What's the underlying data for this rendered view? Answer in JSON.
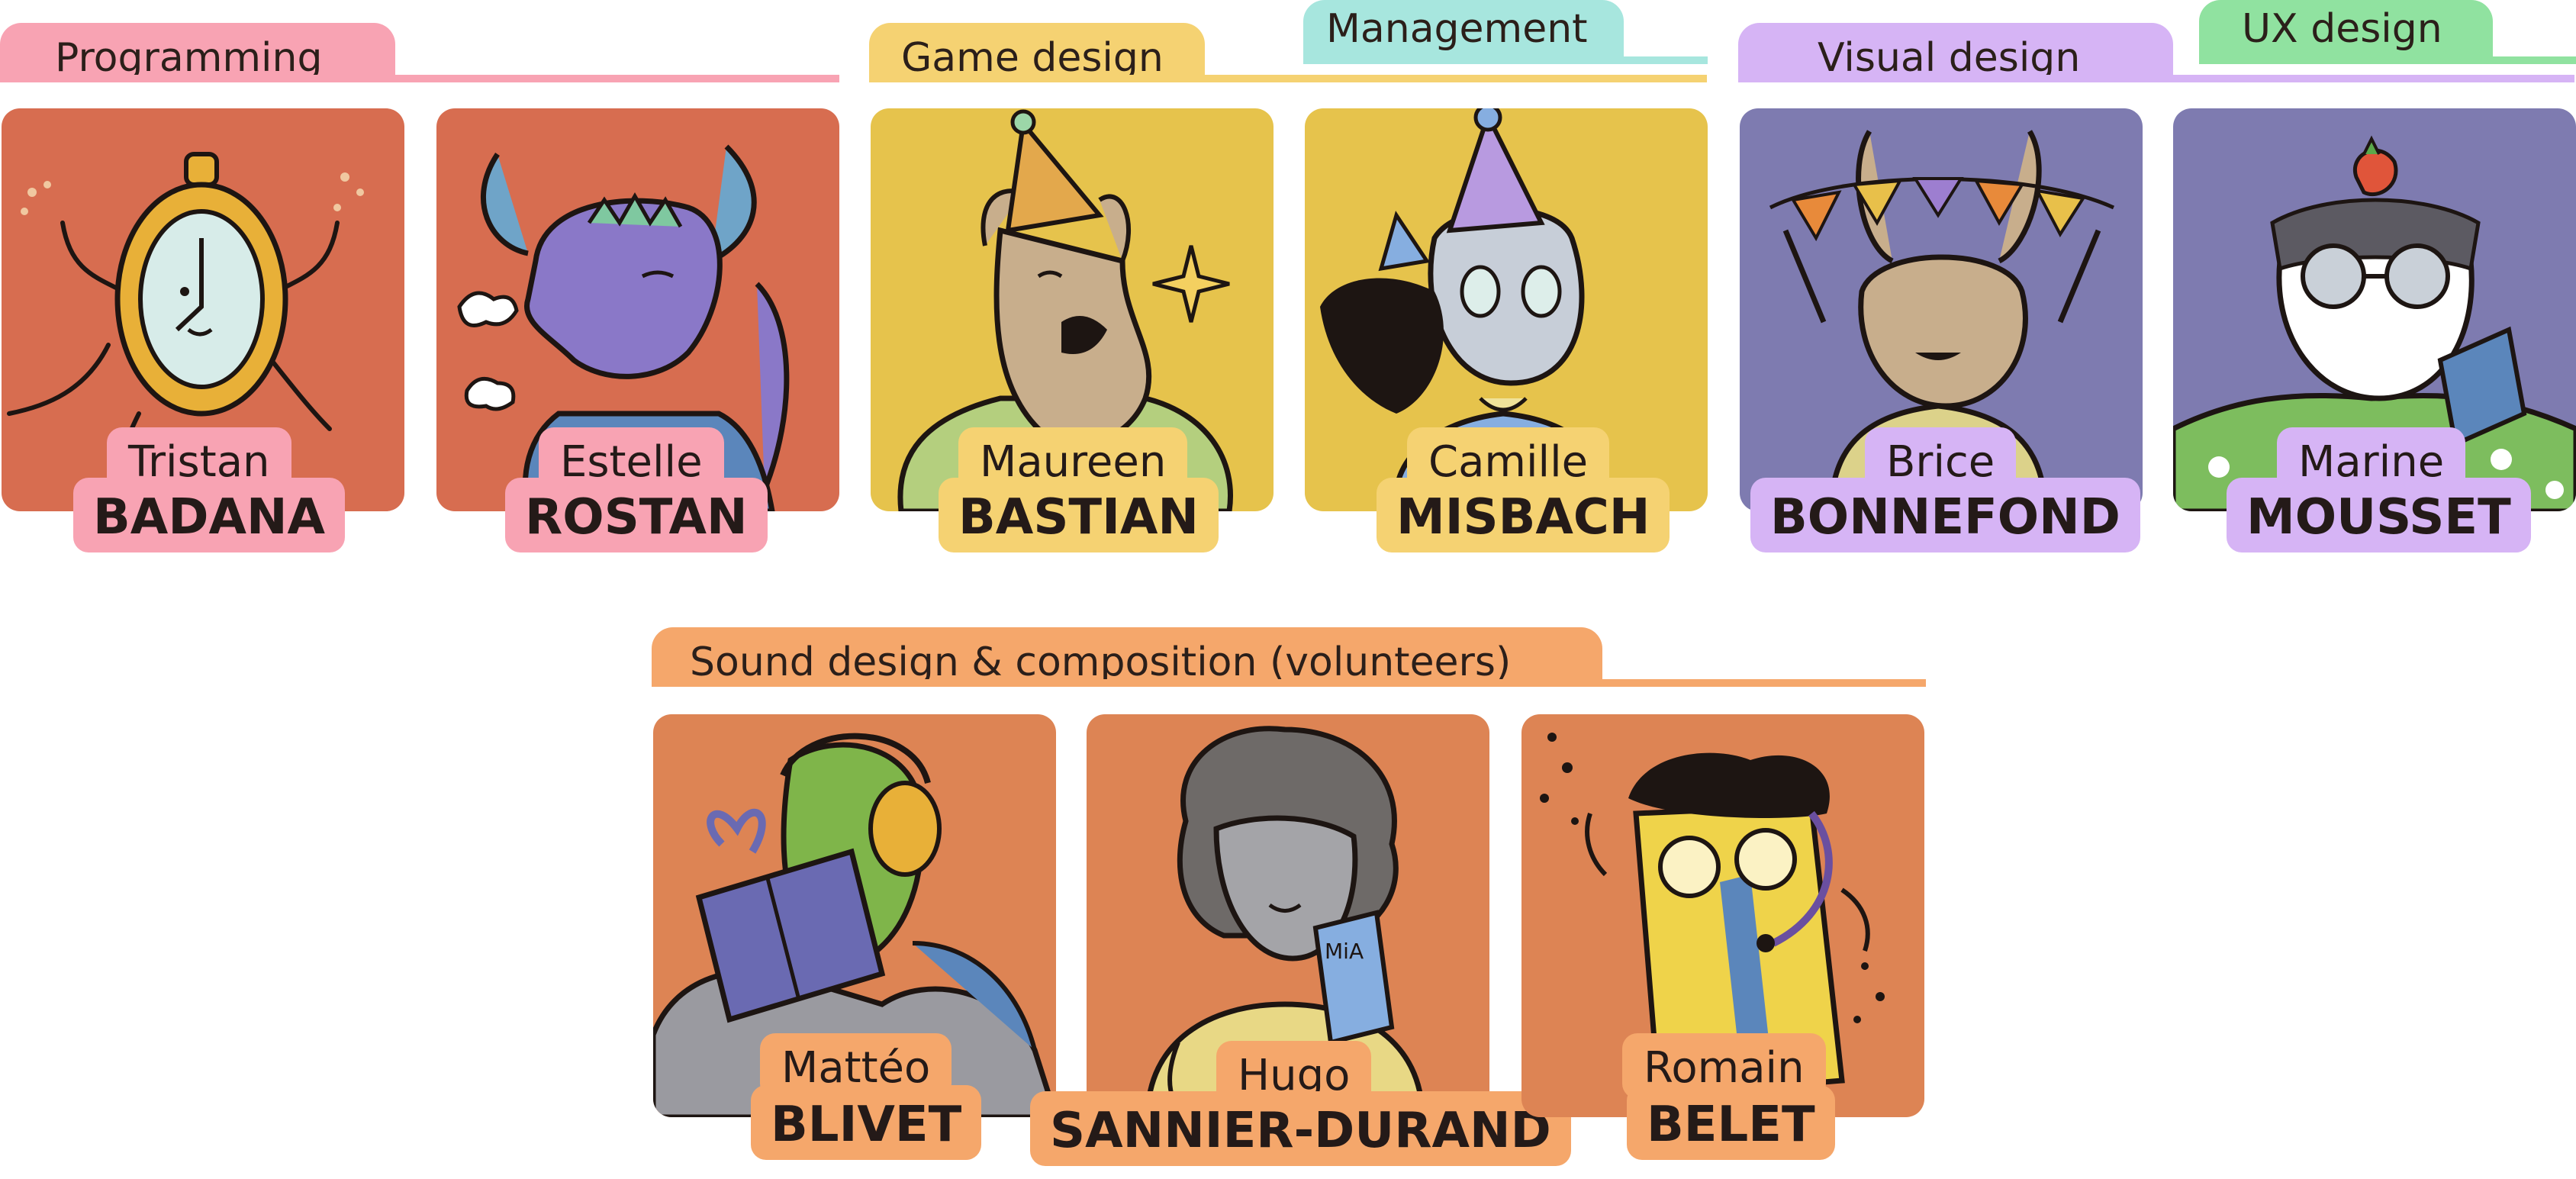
{
  "colors": {
    "programming": "#f8a3b3",
    "game_design": "#f5d272",
    "management": "#a7e6de",
    "visual_design": "#d6b4f5",
    "ux_design": "#90e2a0",
    "sound": "#f5a76b",
    "card_red": "#d76d50",
    "card_yellow": "#e6c34c",
    "card_purple": "#7e7bb0",
    "card_orange": "#dd8454"
  },
  "sections": {
    "programming": "Programming",
    "game_design": "Game design",
    "management": "Management",
    "visual_design": "Visual design",
    "ux_design": "UX design",
    "sound": "Sound design & composition (volunteers)"
  },
  "members": [
    {
      "first": "Tristan",
      "last": "BADANA",
      "avatar": "pocket-watch-character"
    },
    {
      "first": "Estelle",
      "last": "ROSTAN",
      "avatar": "purple-horned-dragon"
    },
    {
      "first": "Maureen",
      "last": "BASTIAN",
      "avatar": "party-hat-kangaroo"
    },
    {
      "first": "Camille",
      "last": "MISBACH",
      "avatar": "party-hat-cat-with-crow"
    },
    {
      "first": "Brice",
      "last": "BONNEFOND",
      "avatar": "bunny-with-bunting"
    },
    {
      "first": "Marine",
      "last": "MOUSSET",
      "avatar": "strawberry-glasses-raccoon"
    },
    {
      "first": "Mattéo",
      "last": "BLIVET",
      "avatar": "bird-with-headphones-and-gift"
    },
    {
      "first": "Hugo",
      "last": "SANNIER-DURAND",
      "avatar": "curly-haired-kid-with-phone"
    },
    {
      "first": "Romain",
      "last": "BELET",
      "avatar": "battery-with-headset"
    }
  ]
}
